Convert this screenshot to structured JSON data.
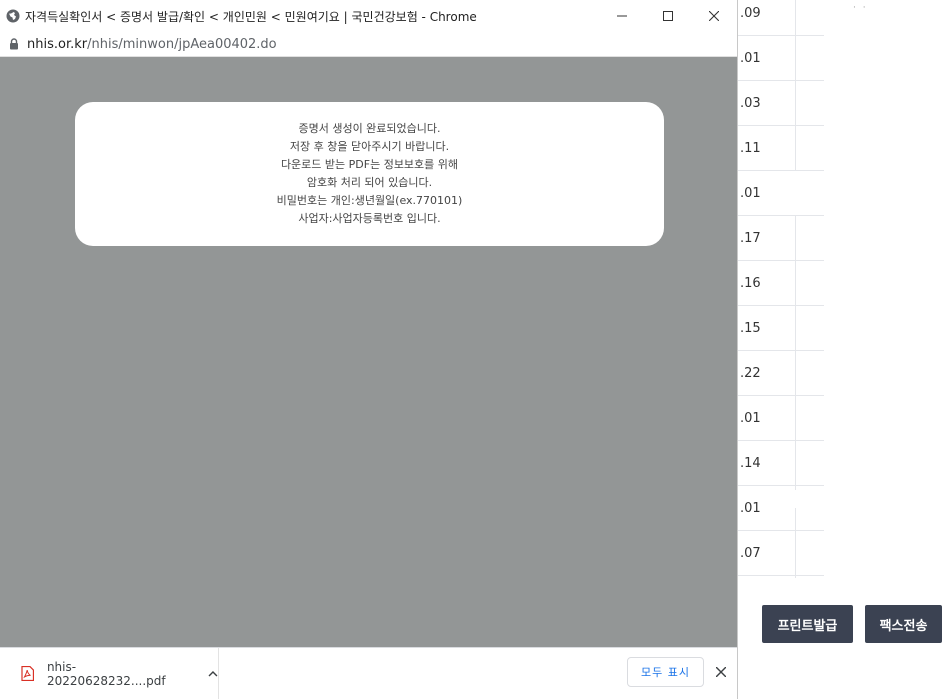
{
  "popup": {
    "title": "자격득실확인서 < 증명서 발급/확인 < 개인민원 < 민원여기요 | 국민건강보험 - Chrome",
    "url_host": "nhis.or.kr",
    "url_path": "/nhis/minwon/jpAea00402.do",
    "dialog_lines": [
      "증명서 생성이 완료되었습니다.",
      "저장 후 창을 닫아주시기 바랍니다.",
      "다운로드 받는 PDF는 정보보호를 위해",
      "암호화 처리 되어 있습니다.",
      "비밀번호는 개인:생년월일(ex.770101)",
      "사업자:사업자등록번호 입니다."
    ],
    "download": {
      "filename": "nhis-20220628232....pdf",
      "show_all_label": "모두 표시"
    }
  },
  "background": {
    "rows": [
      ".09",
      ".01",
      ".03",
      ".11",
      ".01",
      ".17",
      ".16",
      ".15",
      ".22",
      ".01",
      ".14",
      ".01",
      ".07"
    ],
    "buttons": {
      "print_label": "프린트발급",
      "fax_label": "팩스전송"
    }
  },
  "colors": {
    "overlay": "#939696",
    "button_bg": "#3b4252",
    "link_blue": "#1a73e8",
    "pdf_red": "#d93025"
  }
}
